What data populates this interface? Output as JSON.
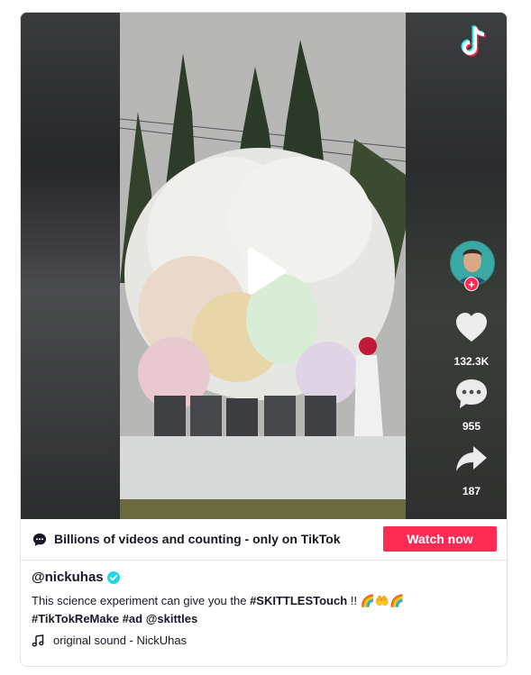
{
  "video": {
    "like_count": "132.3K",
    "comment_count": "955",
    "share_count": "187"
  },
  "banner": {
    "text": "Billions of videos and counting - only on TikTok",
    "watch_button": "Watch now"
  },
  "post": {
    "username": "@nickuhas",
    "description_prefix": "This science experiment can give you the ",
    "hashtag_1": "#SKITTLESTouch",
    "description_mid": " !! ",
    "emoji_1": "🌈",
    "emoji_2": "🤲",
    "emoji_3": "🌈",
    "hashtag_2": "#TikTokReMake",
    "hashtag_3": "#ad",
    "mention": "@skittles",
    "sound": "original sound - NickUhas"
  },
  "colors": {
    "accent": "#fe2c55",
    "verified": "#20d5ec",
    "text": "#161823"
  }
}
